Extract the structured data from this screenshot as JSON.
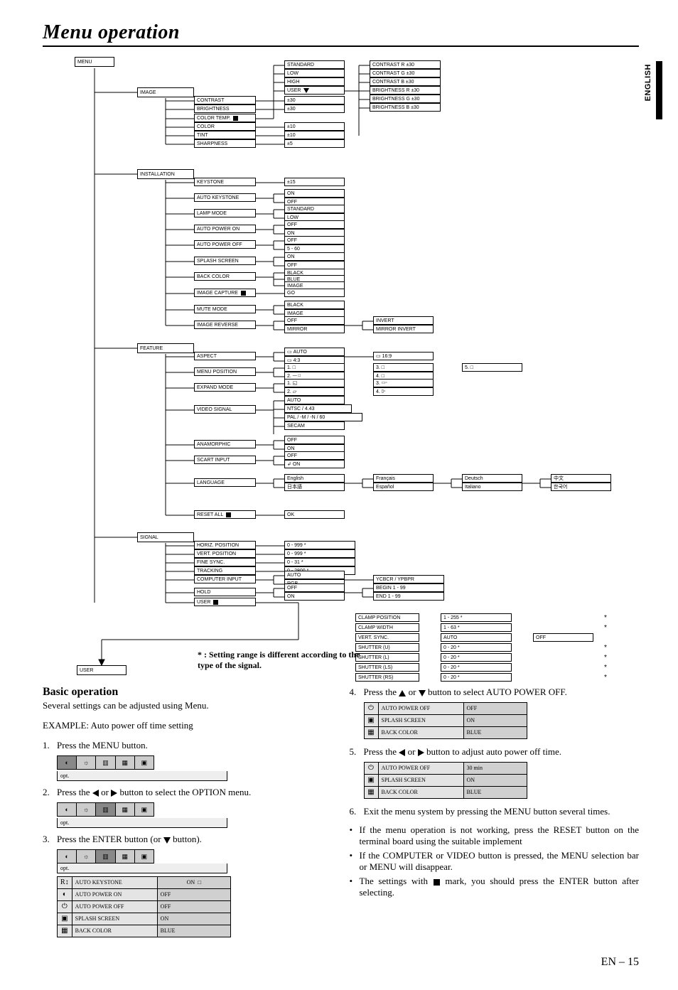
{
  "page": {
    "title": "Menu operation",
    "lang_tab": "ENGLISH",
    "page_number": "EN – 15"
  },
  "tree": {
    "root": "MENU",
    "image": {
      "label": "IMAGE",
      "items": [
        "CONTRAST",
        "BRIGHTNESS",
        "COLOR TEMP.",
        "COLOR",
        "TINT",
        "SHARPNESS"
      ],
      "color_temp_sub": "USER"
    },
    "install": {
      "label": "INSTALLATION",
      "items": [
        "KEYSTONE",
        "AUTO KEYSTONE",
        "LAMP MODE",
        "AUTO POWER ON",
        "AUTO POWER OFF",
        "SPLASH SCREEN",
        "BACK COLOR",
        "IMAGE CAPTURE",
        "MUTE MODE",
        "IMAGE REVERSE"
      ]
    },
    "feature": {
      "label": "FEATURE",
      "items": [
        "ASPECT",
        "MENU POSITION",
        "EXPAND MODE",
        "VIDEO SIGNAL",
        "ANAMORPHIC",
        "SCART INPUT",
        "LANGUAGE",
        "RESET ALL"
      ]
    },
    "signal": {
      "label": "SIGNAL",
      "items": [
        "HORIZ. POSITION",
        "VERT. POSITION",
        "FINE SYNC.",
        "TRACKING",
        "COMPUTER INPUT",
        "HOLD",
        "USER"
      ]
    },
    "user": {
      "label": "USER",
      "items": [
        "CLAMP POSITION",
        "CLAMP WIDTH",
        "VERT. SYNC.",
        "SHUTTER (U)",
        "SHUTTER (L)",
        "SHUTTER (LS)",
        "SHUTTER (RS)"
      ]
    },
    "leaves": {
      "contrast": "±30",
      "brightness": "±30",
      "color": "±10",
      "tint": "±10",
      "sharpness": "±5",
      "ct_standard": "STANDARD",
      "ct_low": "LOW",
      "ct_high": "HIGH",
      "ct_user": "USER",
      "ct_r": "CONTRAST R ±30",
      "ct_g": "CONTRAST G ±30",
      "ct_b": "CONTRAST B ±30",
      "bt_r": "BRIGHTNESS R ±30",
      "bt_g": "BRIGHTNESS G ±30",
      "bt_b": "BRIGHTNESS B ±30",
      "keystone": "±15",
      "ak_on": "ON",
      "ak_off": "OFF",
      "lm_std": "STANDARD",
      "lm_low": "LOW",
      "apon_on": "ON",
      "apon_off": "OFF",
      "apoff_off": "OFF",
      "apoff_60": "5 - 60",
      "ss_on": "ON",
      "ss_off": "OFF",
      "bc_black": "BLACK",
      "bc_blue": "BLUE",
      "bc_img": "IMAGE",
      "ic_go": "GO",
      "mm_black": "BLACK",
      "mm_img": "IMAGE",
      "ir_off": "OFF",
      "ir_mir": "MIRROR",
      "ir_inv": "INVERT",
      "ir_mi": "MIRROR INVERT",
      "as_auto": "AUTO",
      "as_43": "4:3",
      "as_169": "16:9",
      "mp_1": "1.",
      "mp_2": "2.",
      "em_1": "1.",
      "em_3": "3.",
      "vs_auto": "AUTO",
      "vs_ntsc": "NTSC / 4.43",
      "vs_pal": "PAL / -M / -N / 60",
      "vs_secam": "SECAM",
      "ana_on": "ON",
      "ana_off": "OFF",
      "sc_on": "ON",
      "sc_off": "OFF",
      "ra_ok": "OK",
      "lang_en": "English",
      "lang_fr": "Français",
      "lang_es": "Español",
      "lang_de": "Deutsch",
      "lang_it": "Italiano",
      "lang_jp": "日本語",
      "lang_cn": "中文",
      "lang_kr": "한국어",
      "hp": "0 - 999  *",
      "vp": "0 - 999  *",
      "fs": "0 - 31  *",
      "tr": "0 - 2800  *",
      "ci_auto": "AUTO",
      "ci_rgb": "RGB",
      "ci_y": "YCBCR / YPBPR",
      "hd_off": "OFF",
      "hd_on": "ON",
      "hd_begin": "BEGIN 1 - 99",
      "hd_end": "END 1 - 99",
      "usr_goto": "",
      "cp": "1 - 255  *",
      "cw": "1 - 63  *",
      "vs": "AUTO",
      "vs2": "OFF",
      "shu": "0 - 20  *",
      "shl": "0 - 20  *",
      "shls": "0 - 20  *",
      "shrs": "0 - 20  *"
    },
    "footnote": "* : Setting range is different according to the type of the signal."
  },
  "basic": {
    "heading": "Basic operation",
    "intro": "Several settings can be adjusted using Menu.",
    "example": "EXAMPLE: Auto power off time setting",
    "steps": {
      "1": "Press the MENU button.",
      "2_a": "Press the ",
      "2_b": " or ",
      "2_c": " button to select the OPTION menu.",
      "3_a": "Press the ENTER button (or ",
      "3_b": " button).",
      "4_a": "Press the ",
      "4_b": " or ",
      "4_c": " button to select AUTO POWER OFF.",
      "5_a": "Press the ",
      "5_b": " or ",
      "5_c": " button to adjust auto power off time.",
      "6": "Exit the menu system by pressing the MENU button several times."
    },
    "strip_label1": "opt.",
    "strip_label2": "opt.",
    "table3": {
      "title": "opt.",
      "rows": [
        [
          "R↕",
          "AUTO KEYSTONE",
          "ON"
        ],
        [
          "◐",
          "AUTO POWER ON",
          "OFF"
        ],
        [
          "⏻",
          "AUTO POWER OFF",
          "OFF"
        ],
        [
          "▣",
          "SPLASH SCREEN",
          "ON"
        ],
        [
          "▦",
          "BACK COLOR",
          "BLUE"
        ]
      ]
    },
    "table4": {
      "rows": [
        [
          "⏻",
          "AUTO POWER OFF",
          "OFF"
        ],
        [
          "▣",
          "SPLASH SCREEN",
          "ON"
        ],
        [
          "▦",
          "BACK COLOR",
          "BLUE"
        ]
      ]
    },
    "table5": {
      "rows": [
        [
          "⏻",
          "AUTO POWER OFF",
          "30 min"
        ],
        [
          "▣",
          "SPLASH SCREEN",
          "ON"
        ],
        [
          "▦",
          "BACK COLOR",
          "BLUE"
        ]
      ]
    },
    "bullets": [
      "If the menu operation is not working, press the RESET button on the terminal board using the suitable implement",
      "If the COMPUTER or VIDEO button is pressed, the MENU selection bar or MENU will disappear.",
      "The settings with ■ mark, you should press the ENTER button after selecting."
    ]
  }
}
